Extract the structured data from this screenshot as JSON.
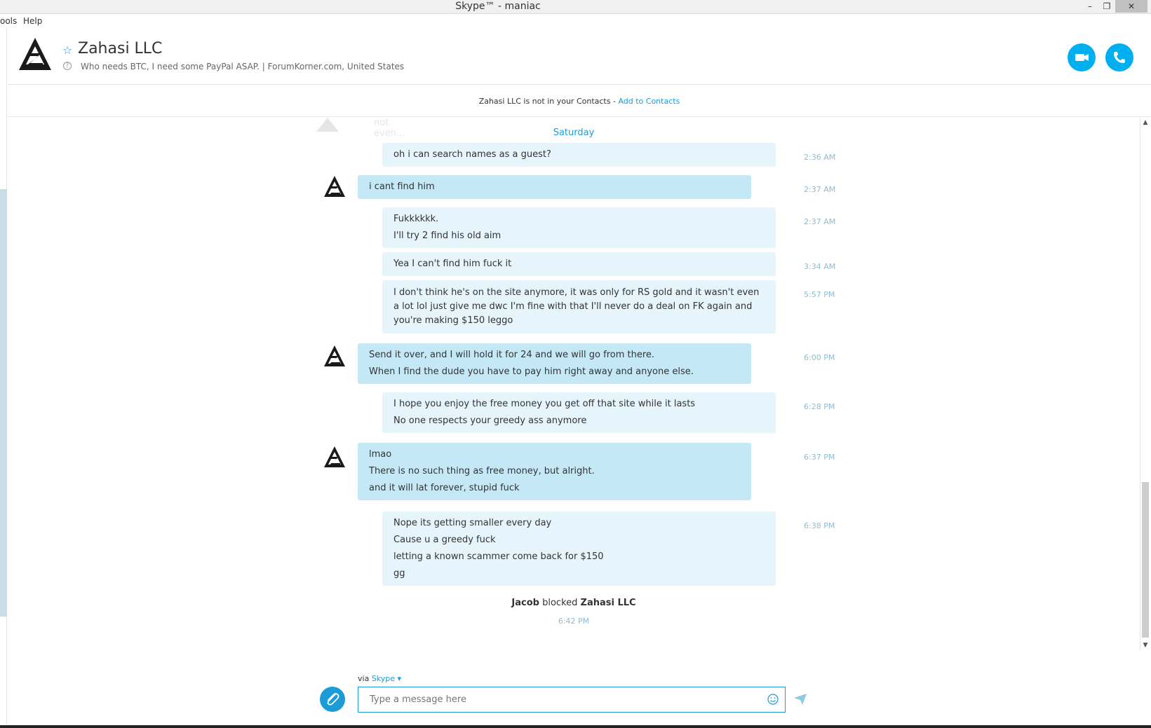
{
  "window": {
    "title": "Skype™ - maniac"
  },
  "menu": {
    "tools": "ools",
    "help": "Help"
  },
  "contact": {
    "name": "Zahasi LLC",
    "mood": "Who needs BTC, I need some PayPal ASAP.  |  ForumKorner.com, United States"
  },
  "notice": {
    "text": "Zahasi LLC is not in your Contacts - ",
    "link": "Add to Contacts"
  },
  "chat": {
    "faded_text": "not even...",
    "day_label": "Saturday",
    "messages": [
      {
        "from": "mine",
        "lines": [
          "oh i can search names as a guest?"
        ],
        "time": "2:36 AM"
      },
      {
        "from": "theirs",
        "lines": [
          "i cant find him"
        ],
        "time": "2:37 AM"
      },
      {
        "from": "mine",
        "lines": [
          "Fukkkkkk.",
          "I'll try 2 find his old aim"
        ],
        "time": "2:37 AM"
      },
      {
        "from": "mine",
        "lines": [
          "Yea I can't find him fuck it"
        ],
        "time": "3:34 AM"
      },
      {
        "from": "mine",
        "lines": [
          "I don't think he's on the site anymore, it was only for RS gold and it wasn't even a lot lol just give me dwc I'm fine with that I'll never do a deal on FK again and you're making $150 leggo"
        ],
        "time": "5:57 PM"
      },
      {
        "from": "theirs",
        "lines": [
          "Send it over, and I will hold it for 24 and we will go from there.",
          "When I find the dude you have to pay him right away and anyone else."
        ],
        "time": "6:00 PM"
      },
      {
        "from": "mine",
        "lines": [
          "I hope you enjoy the free money you get off that site while it lasts",
          "No one respects your greedy ass anymore"
        ],
        "time": "6:28 PM"
      },
      {
        "from": "theirs",
        "lines": [
          "lmao",
          "There is no such thing as free money, but alright.",
          "and it will lat forever, stupid fuck"
        ],
        "time": "6:37 PM"
      },
      {
        "from": "mine",
        "lines": [
          "Nope its getting smaller every day",
          "Cause u a greedy fuck",
          "letting a known scammer come back for $150",
          "gg"
        ],
        "time": "6:38 PM"
      }
    ],
    "blocked": {
      "actor": "Jacob",
      "verb": " blocked ",
      "target": "Zahasi LLC",
      "time": "6:42 PM"
    }
  },
  "composer": {
    "via_prefix": "via ",
    "via_service": "Skype",
    "placeholder": "Type a message here"
  },
  "icons": {
    "attach": "paperclip-icon",
    "emoji": "smiley-icon",
    "send": "send-icon",
    "video": "video-call-icon",
    "call": "phone-icon",
    "favorite": "star-icon"
  },
  "colors": {
    "accent": "#00aff0",
    "link": "#1b9bd7",
    "bubble_mine": "#e6f4fb",
    "bubble_theirs": "#c5e8f7"
  }
}
